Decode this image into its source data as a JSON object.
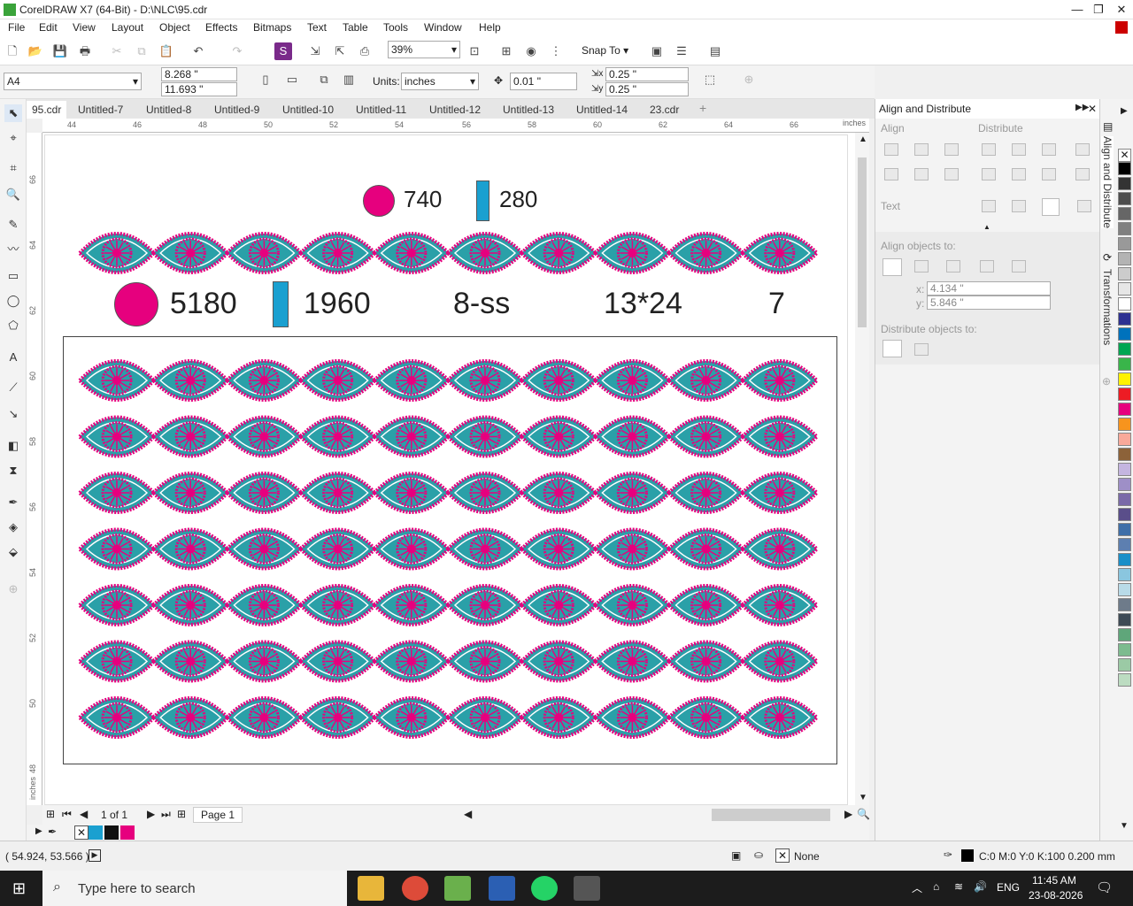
{
  "window": {
    "title": "CorelDRAW X7 (64-Bit) - D:\\NLC\\95.cdr"
  },
  "menu": [
    "File",
    "Edit",
    "View",
    "Layout",
    "Object",
    "Effects",
    "Bitmaps",
    "Text",
    "Table",
    "Tools",
    "Window",
    "Help"
  ],
  "toolbar": {
    "zoom": "39%",
    "snap_to": "Snap To"
  },
  "propbar": {
    "page_size": "A4",
    "width": "8.268 \"",
    "height": "11.693 \"",
    "units_label": "Units:",
    "units": "inches",
    "nudge": "0.01 \"",
    "dup_x": "0.25 \"",
    "dup_y": "0.25 \""
  },
  "tabs": [
    "95.cdr",
    "Untitled-7",
    "Untitled-8",
    "Untitled-9",
    "Untitled-10",
    "Untitled-11",
    "Untitled-12",
    "Untitled-13",
    "Untitled-14",
    "23.cdr"
  ],
  "ruler": {
    "h_ticks": [
      "44",
      "46",
      "48",
      "50",
      "52",
      "54",
      "56",
      "58",
      "60",
      "62",
      "64",
      "66"
    ],
    "h_unit": "inches",
    "v_ticks": [
      "66",
      "64",
      "62",
      "60",
      "58",
      "56",
      "54",
      "52",
      "50",
      "48"
    ],
    "v_unit": "inches"
  },
  "design": {
    "small_circle_count": "740",
    "small_rect_count": "280",
    "big_circle_count": "5180",
    "big_rect_count": "1960",
    "stone_size": "8-ss",
    "dimensions": "13*24",
    "rows": "7",
    "magenta": "#e6007e",
    "cyan": "#1aa0d0"
  },
  "pagebar": {
    "page_of": "1 of 1",
    "page_tab": "Page 1"
  },
  "docker": {
    "title": "Align and Distribute",
    "align": "Align",
    "distribute": "Distribute",
    "text": "Text",
    "align_objects_to": "Align objects to:",
    "x_label": "x:",
    "x_value": "4.134 \"",
    "y_label": "y:",
    "y_value": "5.846 \"",
    "distribute_objects_to": "Distribute objects to:"
  },
  "docker_tabs": {
    "align": "Align and Distribute",
    "transform": "Transformations"
  },
  "status": {
    "coords": "( 54.924, 53.566 )",
    "fill": "None",
    "outline": "C:0 M:0 Y:0 K:100  0.200 mm"
  },
  "taskbar": {
    "search_placeholder": "Type here to search",
    "lang": "ENG",
    "time": "11:45 AM",
    "date": "23-08-2026"
  },
  "palette_colors": [
    "#000000",
    "#333333",
    "#4d4d4d",
    "#666666",
    "#808080",
    "#999999",
    "#b3b3b3",
    "#cccccc",
    "#e6e6e6",
    "#ffffff",
    "#2e3192",
    "#0072bc",
    "#00a651",
    "#39b54a",
    "#fff200",
    "#ed1c24",
    "#e6007e",
    "#f7941d",
    "#f9a99a",
    "#8c6239",
    "#c4b5e0",
    "#9e8fc7",
    "#7a6aa8",
    "#5a4e8a",
    "#3f6fa8",
    "#5d7fb0",
    "#1a8fc8",
    "#8ac6df",
    "#b9dbe8",
    "#6e7b8a",
    "#3e4a55",
    "#5fa67a",
    "#7dbb8f",
    "#9bcaa5",
    "#bcdcc1"
  ]
}
